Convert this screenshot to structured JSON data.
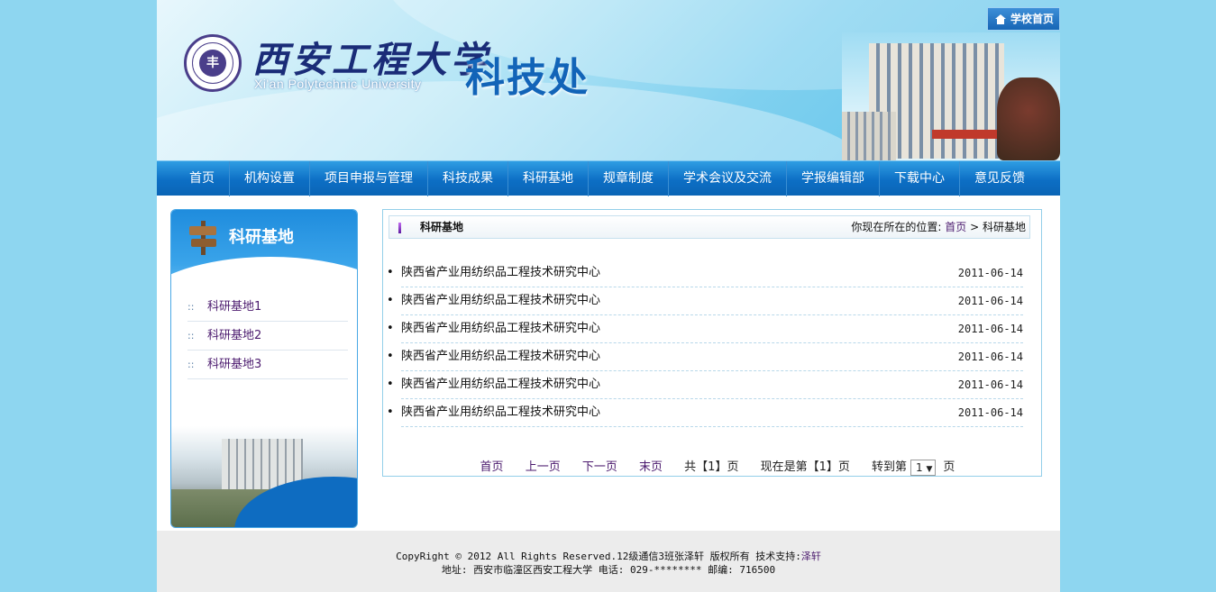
{
  "header": {
    "university_cn": "西安工程大学",
    "university_en": "Xi'an Polytechnic University",
    "department": "科技处",
    "home_link": "学校首页",
    "logo_seal_text": "西安工程大学"
  },
  "nav": {
    "items": [
      "首页",
      "机构设置",
      "项目申报与管理",
      "科技成果",
      "科研基地",
      "规章制度",
      "学术会议及交流",
      "学报编辑部",
      "下载中心",
      "意见反馈"
    ]
  },
  "sidebar": {
    "title": "科研基地",
    "items": [
      {
        "label": "科研基地1"
      },
      {
        "label": "科研基地2"
      },
      {
        "label": "科研基地3"
      }
    ],
    "bullet": "::"
  },
  "main": {
    "title": "科研基地",
    "breadcrumb_prefix": "你现在所在的位置:",
    "breadcrumb_home": "首页",
    "breadcrumb_sep": ">",
    "breadcrumb_current": "科研基地",
    "list": [
      {
        "title": "陕西省产业用纺织品工程技术研究中心",
        "date": "2011-06-14"
      },
      {
        "title": "陕西省产业用纺织品工程技术研究中心",
        "date": "2011-06-14"
      },
      {
        "title": "陕西省产业用纺织品工程技术研究中心",
        "date": "2011-06-14"
      },
      {
        "title": "陕西省产业用纺织品工程技术研究中心",
        "date": "2011-06-14"
      },
      {
        "title": "陕西省产业用纺织品工程技术研究中心",
        "date": "2011-06-14"
      },
      {
        "title": "陕西省产业用纺织品工程技术研究中心",
        "date": "2011-06-14"
      }
    ],
    "pager": {
      "first": "首页",
      "prev": "上一页",
      "next": "下一页",
      "last": "末页",
      "total": "共【1】页",
      "current": "现在是第【1】页",
      "goto_label": "转到第",
      "goto_value": "1",
      "goto_suffix": "页"
    }
  },
  "footer": {
    "line1_text": "CopyRight © 2012 All Rights Reserved.12级通信3班张泽轩 版权所有 技术支持:",
    "line1_link": "泽轩",
    "line2": "地址: 西安市临潼区西安工程大学 电话: 029-******** 邮编: 716500"
  },
  "colors": {
    "page_bg": "#8ed6f0",
    "nav_bg": "#0d6fc5",
    "link": "#4b1a6e"
  }
}
